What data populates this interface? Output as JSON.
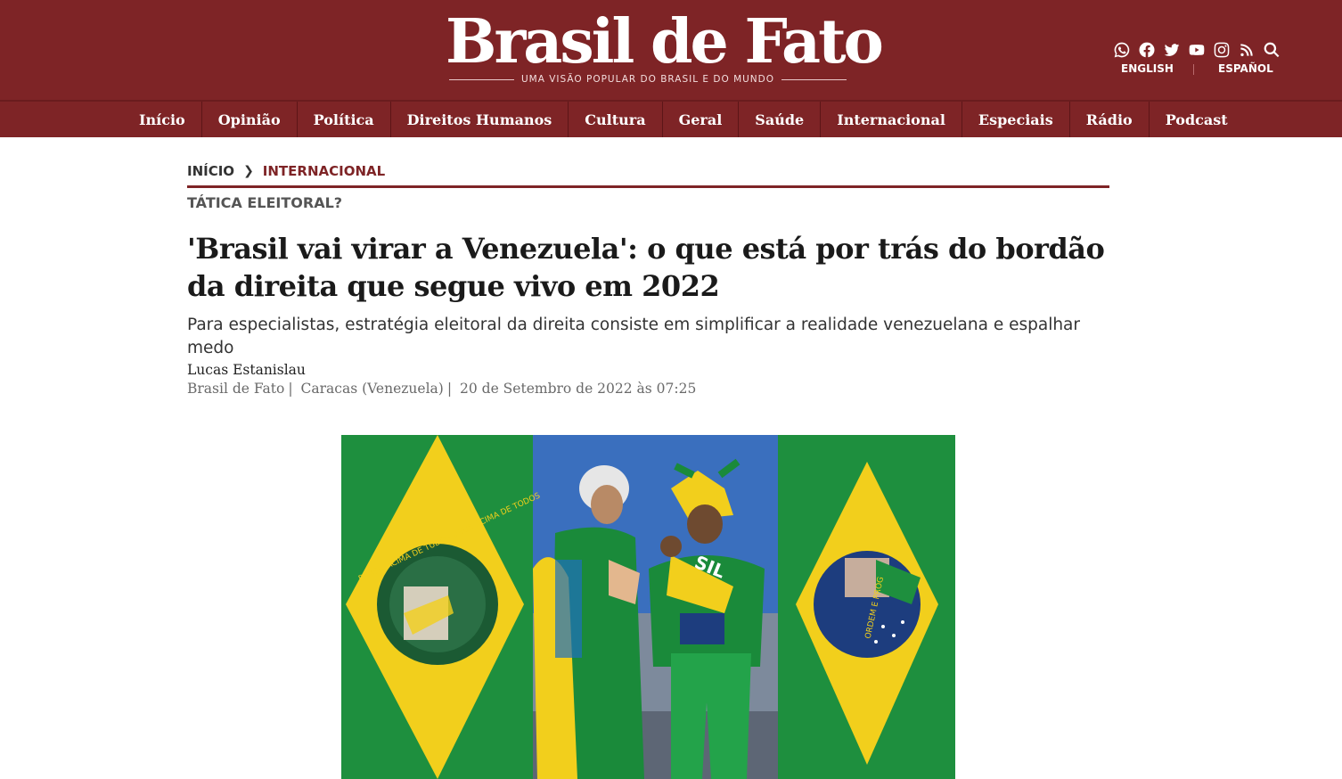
{
  "brand": {
    "name": "Brasil de Fato",
    "tagline": "UMA VISÃO POPULAR DO BRASIL E DO MUNDO",
    "colors": {
      "primary": "#7e2426",
      "text": "#1a1a1a"
    }
  },
  "header": {
    "social_icons": [
      "whatsapp-icon",
      "facebook-icon",
      "twitter-icon",
      "youtube-icon",
      "instagram-icon",
      "rss-icon",
      "search-icon"
    ],
    "languages": {
      "english": "ENGLISH",
      "spanish": "ESPAÑOL"
    }
  },
  "nav": {
    "items": [
      "Início",
      "Opinião",
      "Política",
      "Direitos Humanos",
      "Cultura",
      "Geral",
      "Saúde",
      "Internacional",
      "Especiais",
      "Rádio",
      "Podcast"
    ]
  },
  "article": {
    "breadcrumb": {
      "home": "INÍCIO",
      "current": "INTERNACIONAL"
    },
    "kicker": "TÁTICA ELEITORAL?",
    "headline": "'Brasil vai virar a Venezuela': o que está por trás do bordão da direita que segue vivo em 2022",
    "subhead": "Para especialistas, estratégia eleitoral da direita consiste em simplificar a realidade venezuelana e espalhar medo",
    "author": "Lucas Estanislau",
    "meta": {
      "outlet": "Brasil de Fato",
      "location": "Caracas (Venezuela)",
      "date": "20 de Setembro de 2022 às 07:25"
    },
    "photo": {
      "flag_left_text": "BRASIL ACIMA DE TUDO · DEUS ACIMA DE TODOS",
      "flag_right_text": "ORDEM E PROG",
      "shirt_text": "SIL"
    }
  }
}
